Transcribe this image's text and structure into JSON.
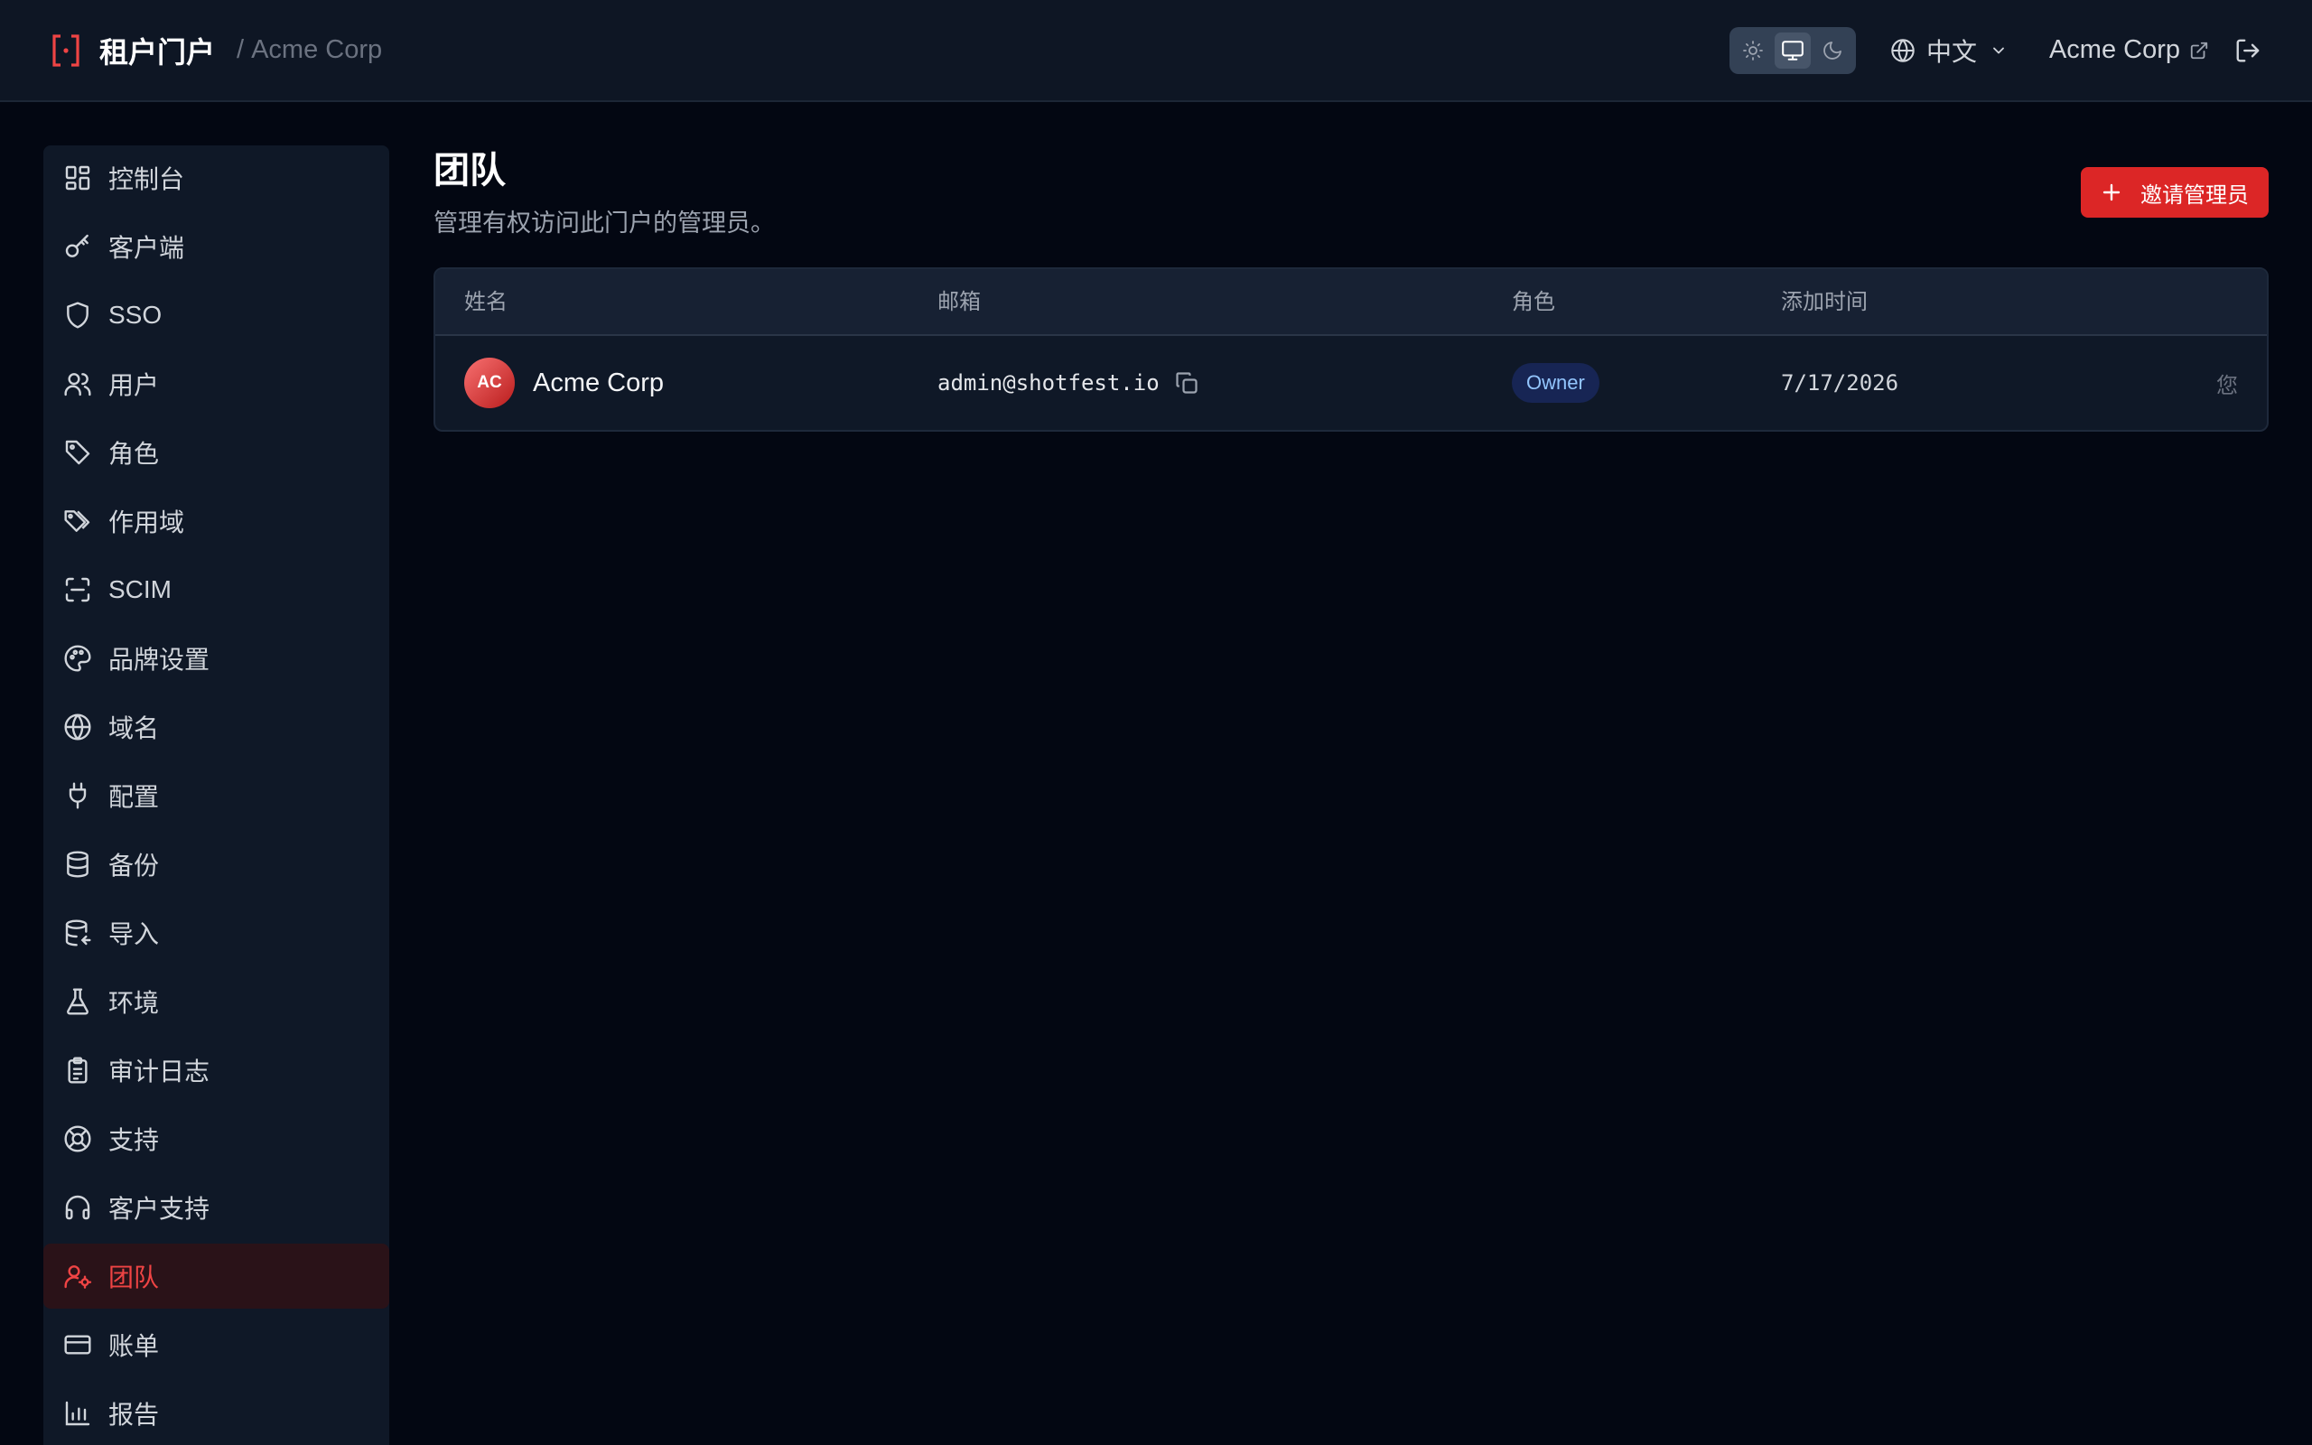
{
  "header": {
    "title": "租户门户",
    "separator": "/",
    "tenant": "Acme Corp",
    "language": "中文",
    "tenant_link": "Acme Corp",
    "theme_modes": [
      "sun-icon",
      "monitor-icon",
      "moon-icon"
    ],
    "theme_active": "monitor"
  },
  "sidebar": {
    "items": [
      {
        "label": "控制台",
        "icon": "dashboard-icon"
      },
      {
        "label": "客户端",
        "icon": "key-icon"
      },
      {
        "label": "SSO",
        "icon": "shield-icon"
      },
      {
        "label": "用户",
        "icon": "users-icon"
      },
      {
        "label": "角色",
        "icon": "tag-icon"
      },
      {
        "label": "作用域",
        "icon": "tags-icon"
      },
      {
        "label": "SCIM",
        "icon": "scan-icon"
      },
      {
        "label": "品牌设置",
        "icon": "palette-icon"
      },
      {
        "label": "域名",
        "icon": "globe-icon"
      },
      {
        "label": "配置",
        "icon": "plug-icon"
      },
      {
        "label": "备份",
        "icon": "database-icon"
      },
      {
        "label": "导入",
        "icon": "database-import-icon"
      },
      {
        "label": "环境",
        "icon": "flask-icon"
      },
      {
        "label": "审计日志",
        "icon": "clipboard-icon"
      },
      {
        "label": "支持",
        "icon": "lifebuoy-icon"
      },
      {
        "label": "客户支持",
        "icon": "headphones-icon"
      },
      {
        "label": "团队",
        "icon": "user-cog-icon",
        "active": true
      },
      {
        "label": "账单",
        "icon": "credit-card-icon"
      },
      {
        "label": "报告",
        "icon": "bar-chart-icon"
      }
    ]
  },
  "main": {
    "title": "团队",
    "subtitle": "管理有权访问此门户的管理员。",
    "invite_label": "邀请管理员",
    "table": {
      "columns": [
        "姓名",
        "邮箱",
        "角色",
        "添加时间"
      ],
      "rows": [
        {
          "initials": "AC",
          "name": "Acme Corp",
          "email": "admin@shotfest.io",
          "role": "Owner",
          "added": "7/17/2026",
          "note": "您"
        }
      ]
    }
  },
  "colors": {
    "accent": "#dc2626",
    "background": "#030712",
    "panel": "#0f1827",
    "active_nav_text": "#ef4444"
  }
}
